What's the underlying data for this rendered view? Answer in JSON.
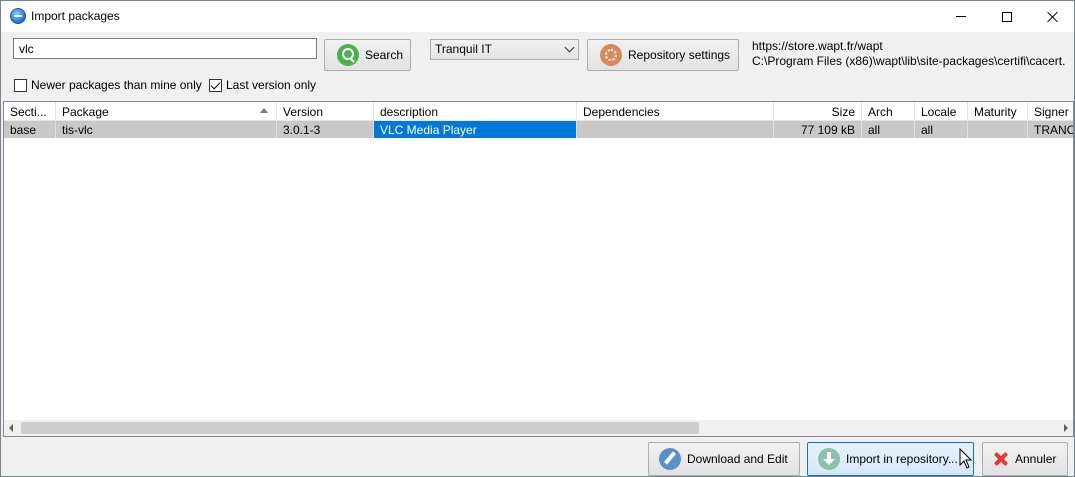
{
  "window": {
    "title": "Import packages"
  },
  "toolbar": {
    "search_value": "vlc",
    "search_label": "Search",
    "source_selected": "Tranquil IT",
    "repo_settings_label": "Repository settings",
    "repo_url": "https://store.wapt.fr/wapt",
    "cert_path": "C:\\Program Files (x86)\\wapt\\lib\\site-packages\\certifi\\cacert.",
    "newer_only_label": "Newer packages than mine only",
    "newer_only_checked": false,
    "last_version_label": "Last version only",
    "last_version_checked": true
  },
  "grid": {
    "columns": [
      "Secti...",
      "Package",
      "Version",
      "description",
      "Dependencies",
      "Size",
      "Arch",
      "Locale",
      "Maturity",
      "Signer"
    ],
    "sorted_column": "Package",
    "rows": [
      {
        "section": "base",
        "package": "tis-vlc",
        "version": "3.0.1-3",
        "description": "VLC Media Player",
        "dependencies": "",
        "size": "77 109 kB",
        "arch": "all",
        "locale": "all",
        "maturity": "",
        "signer": "TRANC"
      }
    ]
  },
  "footer": {
    "download_label": "Download and Edit",
    "import_label": "Import in repository...",
    "cancel_label": "Annuler"
  },
  "colors": {
    "selection": "#0078d7",
    "row_highlight": "#c8c8c8",
    "cancel_icon": "#e53935"
  }
}
